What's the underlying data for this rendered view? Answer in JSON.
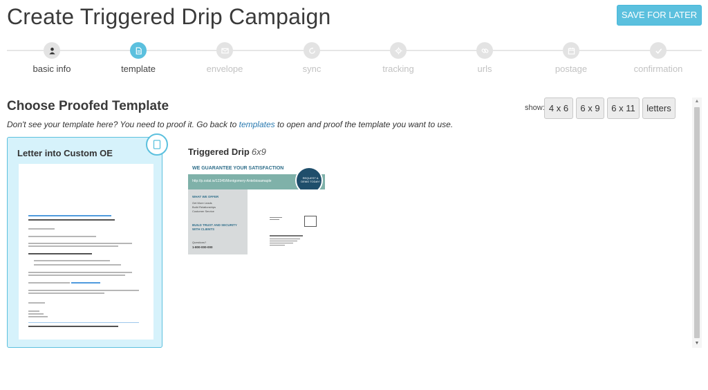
{
  "header": {
    "title": "Create Triggered Drip Campaign",
    "save_label": "SAVE FOR LATER"
  },
  "steps": [
    {
      "label": "basic info",
      "icon": "user-icon",
      "state": "done"
    },
    {
      "label": "template",
      "icon": "document-icon",
      "state": "active"
    },
    {
      "label": "envelope",
      "icon": "envelope-icon",
      "state": "pending"
    },
    {
      "label": "sync",
      "icon": "sync-icon",
      "state": "pending"
    },
    {
      "label": "tracking",
      "icon": "tracking-icon",
      "state": "pending"
    },
    {
      "label": "urls",
      "icon": "link-icon",
      "state": "pending"
    },
    {
      "label": "postage",
      "icon": "calendar-icon",
      "state": "pending"
    },
    {
      "label": "confirmation",
      "icon": "check-icon",
      "state": "pending"
    }
  ],
  "section": {
    "title": "Choose Proofed Template",
    "hint_before": "Don't see your template here? You need to proof it. Go back to ",
    "hint_link": "templates",
    "hint_after": " to open and proof the template you want to use."
  },
  "sizes": {
    "label": "show:",
    "options": [
      "4 x 6",
      "6 x 9",
      "6 x 11",
      "letters"
    ]
  },
  "templates": [
    {
      "name": "Letter into Custom OE",
      "size": "",
      "selected": true
    },
    {
      "name": "Triggered Drip",
      "size": "6x9",
      "selected": false
    }
  ],
  "postcard_preview": {
    "headline": "WE GUARANTEE YOUR SATISFACTION",
    "url": "http://p.ostal.io/12345/Montgomery-Antebiosamaple",
    "badge": "REQUEST A DEMO TODAY!",
    "offer_title": "WHAT WE OFFER",
    "offer_items": [
      "Get More Leads",
      "Build Relationships",
      "Customer Service"
    ],
    "trust": "BUILD TRUST AND SECURITY WITH CLIENTS",
    "question": "Questions?",
    "phone": "1-800-000-000"
  },
  "colors": {
    "accent": "#5bc0de",
    "selected_bg": "#d6f2fb",
    "teal": "#7fb1a9",
    "navy": "#1f4e6b"
  }
}
